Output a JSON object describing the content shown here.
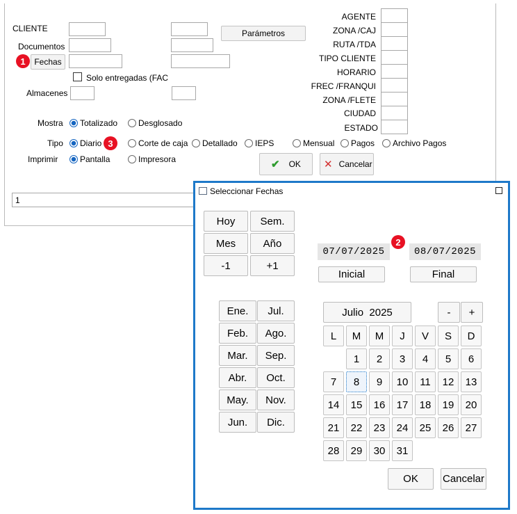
{
  "main": {
    "labels": {
      "cliente": "CLIENTE",
      "documentos": "Documentos",
      "almacenes": "Almacenes",
      "mostra": "Mostra",
      "tipo": "Tipo",
      "imprimir": "Imprimir"
    },
    "fechas_button": "Fechas",
    "parametros_button": "Parámetros",
    "solo_entregadas": "Solo entregadas (FAC",
    "right_labels": [
      "AGENTE",
      "ZONA /CAJ",
      "RUTA /TDA",
      "TIPO CLIENTE",
      "HORARIO",
      "FREC /FRANQUI",
      "ZONA /FLETE",
      "CIUDAD",
      "ESTADO"
    ],
    "mostra_options": {
      "totalizado": "Totalizado",
      "desglosado": "Desglosado"
    },
    "tipo_options": {
      "diario": "Diario",
      "corte": "Corte de caja",
      "detallado": "Detallado",
      "ieps": "IEPS",
      "mensual": "Mensual",
      "pagos": "Pagos",
      "archivo_pagos": "Archivo Pagos"
    },
    "imprimir_options": {
      "pantalla": "Pantalla",
      "impresora": "Impresora"
    },
    "ok_button": "OK",
    "cancelar_button": "Cancelar",
    "status_value": "1"
  },
  "badges": {
    "b1": "1",
    "b2": "2",
    "b3": "3",
    "badge_color": "#e81123"
  },
  "dialog": {
    "title": "Seleccionar Fechas",
    "border_color": "#1e79c9",
    "quick": {
      "hoy": "Hoy",
      "sem": "Sem.",
      "mes": "Mes",
      "anio": "Año",
      "minus1": "-1",
      "plus1": "+1"
    },
    "fecha_inicial": "07/07/2025",
    "fecha_final": "08/07/2025",
    "inicial_button": "Inicial",
    "final_button": "Final",
    "months": [
      "Ene.",
      "Jul.",
      "Feb.",
      "Ago.",
      "Mar.",
      "Sep.",
      "Abr.",
      "Oct.",
      "May.",
      "Nov.",
      "Jun.",
      "Dic."
    ],
    "calendar": {
      "month_year": "Julio  2025",
      "prev": "-",
      "next": "+",
      "weekdays": [
        "L",
        "M",
        "M",
        "J",
        "V",
        "S",
        "D"
      ],
      "days": [
        "1",
        "2",
        "3",
        "4",
        "5",
        "6",
        "7",
        "8",
        "9",
        "10",
        "11",
        "12",
        "13",
        "14",
        "15",
        "16",
        "17",
        "18",
        "19",
        "20",
        "21",
        "22",
        "23",
        "24",
        "25",
        "26",
        "27",
        "28",
        "29",
        "30",
        "31"
      ],
      "selected_day": "8"
    },
    "ok_button": "OK",
    "cancelar_button": "Cancelar"
  }
}
